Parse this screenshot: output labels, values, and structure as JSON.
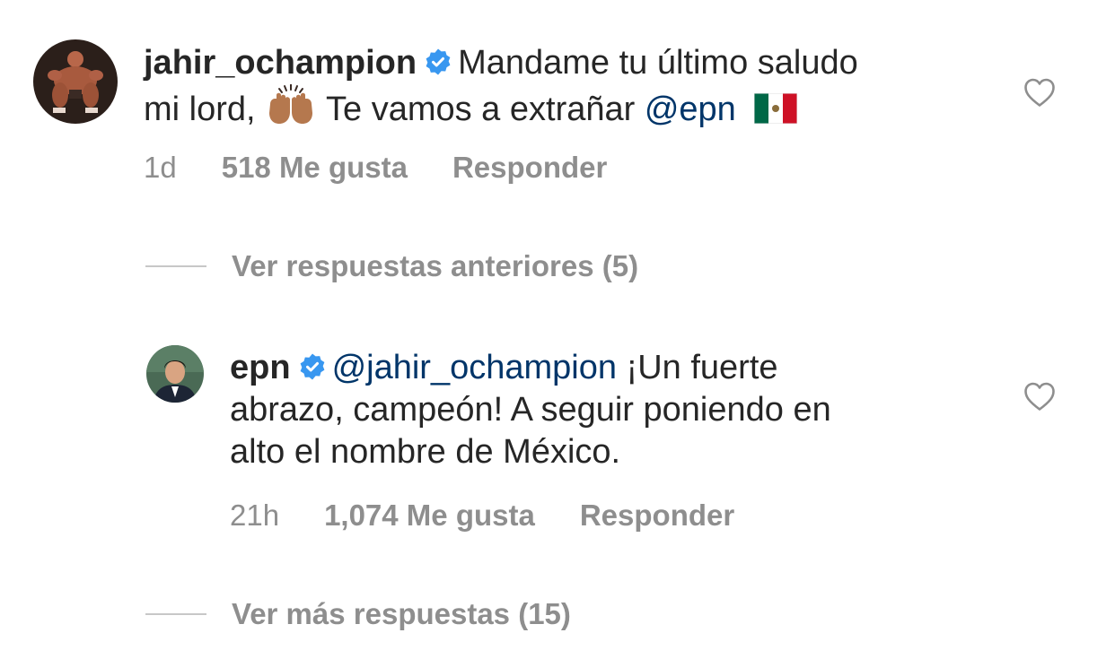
{
  "comments": [
    {
      "username": "jahir_ochampion",
      "verified": true,
      "text_line1": "Mandame tu último saludo",
      "text_line2_a": "mi lord,",
      "emoji_1": "raising-hands",
      "text_line2_b": "Te vamos a extrañar",
      "mention": "@epn",
      "emoji_2": "flag-mexico",
      "time": "1d",
      "likes": "518 Me gusta",
      "reply_label": "Responder"
    },
    {
      "username": "epn",
      "verified": true,
      "mention": "@jahir_ochampion",
      "text_a": "¡Un fuerte",
      "text_b": "abrazo, campeón! A seguir poniendo en",
      "text_c": "alto el nombre de México.",
      "time": "21h",
      "likes": "1,074 Me gusta",
      "reply_label": "Responder"
    }
  ],
  "replies_toggles": {
    "previous": "Ver respuestas anteriores (5)",
    "more": "Ver más respuestas (15)"
  },
  "colors": {
    "text": "#262626",
    "secondary": "#8e8e8e",
    "mention": "#003569",
    "verified": "#3897f0"
  },
  "icons": {
    "like": "heart-outline-icon",
    "verified": "verified-badge-icon"
  }
}
